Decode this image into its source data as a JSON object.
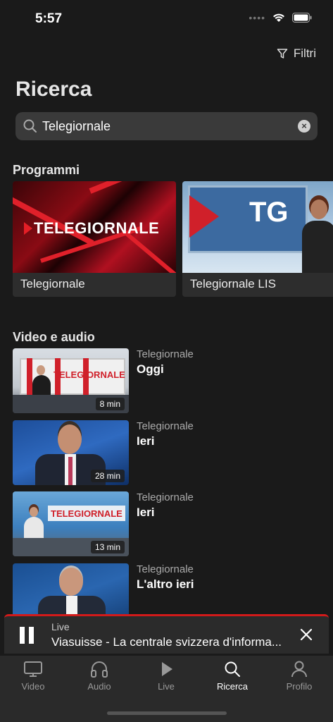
{
  "status": {
    "time": "5:57"
  },
  "header": {
    "filter_label": "Filtri",
    "title": "Ricerca"
  },
  "search": {
    "value": "Telegiornale",
    "clear": "×"
  },
  "programs": {
    "section_title": "Programmi",
    "items": [
      {
        "label": "Telegiornale",
        "logo_text": "TELEGIORNALE"
      },
      {
        "label": "Telegiornale LIS",
        "logo_text": "TG"
      }
    ]
  },
  "videos": {
    "section_title": "Video e audio",
    "items": [
      {
        "show": "Telegiornale",
        "title": "Oggi",
        "duration": "8 min",
        "wall_text": "TELEGIORNALE"
      },
      {
        "show": "Telegiornale",
        "title": "Ieri",
        "duration": "28 min"
      },
      {
        "show": "Telegiornale",
        "title": "Ieri",
        "duration": "13 min",
        "wall_text": "TELEGIORNALE"
      },
      {
        "show": "Telegiornale",
        "title": "L'altro ieri"
      }
    ]
  },
  "mini_player": {
    "live_label": "Live",
    "title": "Viasuisse - La centrale svizzera d'informa...",
    "accent_color": "#d21a1a"
  },
  "tabbar": {
    "items": [
      {
        "label": "Video",
        "icon": "tv-icon"
      },
      {
        "label": "Audio",
        "icon": "headphones-icon"
      },
      {
        "label": "Live",
        "icon": "play-icon"
      },
      {
        "label": "Ricerca",
        "icon": "search-icon",
        "active": true
      },
      {
        "label": "Profilo",
        "icon": "person-icon"
      }
    ]
  }
}
